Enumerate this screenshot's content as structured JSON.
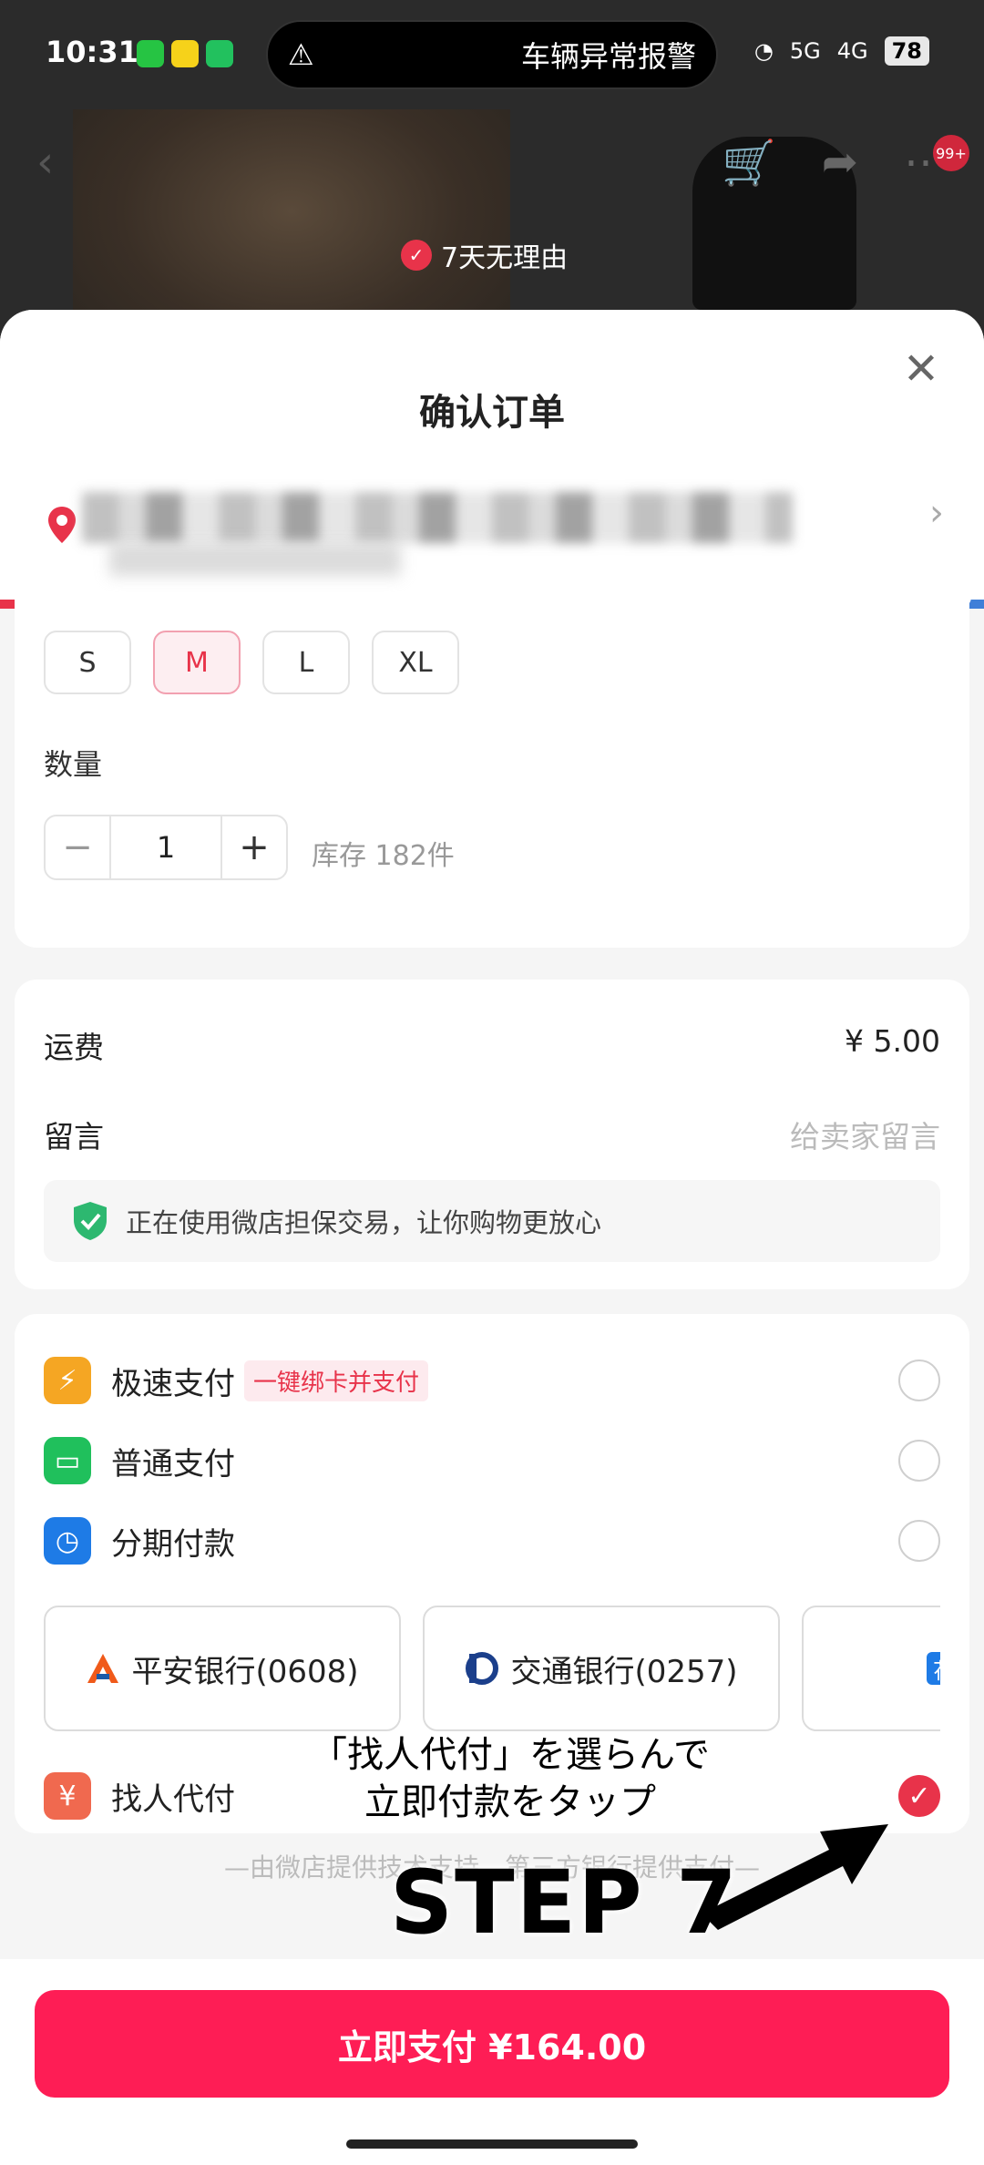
{
  "status_bar": {
    "time": "10:31",
    "notification": "车辆异常报警",
    "battery": "78",
    "signal_1": "5G",
    "signal_2": "4G"
  },
  "background": {
    "badge": "7天无理由",
    "cart_count": "99+"
  },
  "sheet": {
    "title": "确认订单"
  },
  "sizes": {
    "options": [
      "S",
      "M",
      "L",
      "XL"
    ],
    "selected": "M"
  },
  "quantity": {
    "label": "数量",
    "value": "1",
    "stock": "库存 182件"
  },
  "shipping": {
    "fee_label": "运费",
    "fee_value": "¥ 5.00",
    "message_label": "留言",
    "message_placeholder": "给卖家留言",
    "guarantee_text": "正在使用微店担保交易，让你购物更放心"
  },
  "payment": {
    "methods": [
      {
        "label": "极速支付",
        "tag": "一键绑卡并支付",
        "icon": "lightning-icon",
        "color": "#f5a623"
      },
      {
        "label": "普通支付",
        "icon": "wallet-icon",
        "color": "#20c05c"
      },
      {
        "label": "分期付款",
        "icon": "installment-icon",
        "color": "#1e7be6"
      },
      {
        "label": "找人代付",
        "icon": "friend-pay-icon",
        "color": "#f0694f"
      }
    ],
    "banks": [
      {
        "label": "平安银行(0608)"
      },
      {
        "label": "交通银行(0257)"
      },
      {
        "label": "微店"
      }
    ]
  },
  "footer_note": "—由微店提供技术支持，第三方银行提供支付—",
  "pay_button": "立即支付 ¥164.00",
  "tutorial": {
    "line1": "「找人代付」を選らんで",
    "line2": "立即付款をタップ",
    "step": "STEP 7"
  },
  "colors": {
    "accent": "#fe1d55",
    "selected_red": "#e8334a"
  }
}
